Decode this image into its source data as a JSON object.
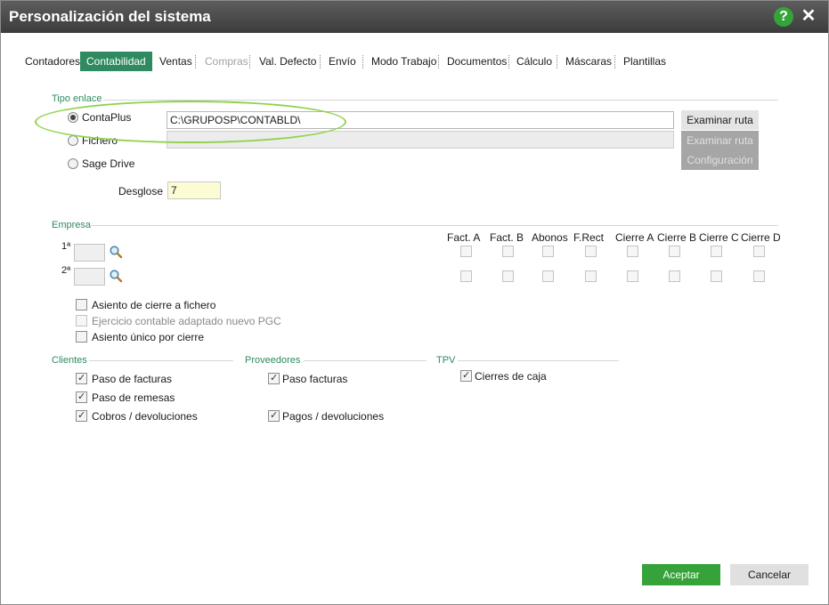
{
  "window": {
    "title": "Personalización del sistema"
  },
  "titlebar": {
    "help_icon": "help-icon",
    "close_icon": "close-icon",
    "help_glyph": "?",
    "close_glyph": "✕"
  },
  "tabs": [
    {
      "label": "Contadores",
      "state": "normal"
    },
    {
      "label": "Contabilidad",
      "state": "active"
    },
    {
      "label": "Ventas",
      "state": "normal"
    },
    {
      "label": "Compras",
      "state": "disabled"
    },
    {
      "label": "Val. Defecto",
      "state": "normal"
    },
    {
      "label": "Envío",
      "state": "normal"
    },
    {
      "label": "Modo Trabajo",
      "state": "normal"
    },
    {
      "label": "Documentos",
      "state": "normal"
    },
    {
      "label": "Cálculo",
      "state": "normal"
    },
    {
      "label": "Máscaras",
      "state": "normal"
    },
    {
      "label": "Plantillas",
      "state": "normal"
    }
  ],
  "tipo_enlace": {
    "section_label": "Tipo enlace",
    "options": [
      {
        "label": "ContaPlus",
        "checked": true
      },
      {
        "label": "Fichero",
        "checked": false
      },
      {
        "label": "Sage Drive",
        "checked": false
      }
    ],
    "path_value": "C:\\GRUPOSP\\CONTABLD\\",
    "fichero_value": "",
    "examinar_ruta_1": "Examinar ruta",
    "examinar_ruta_2": "Examinar ruta",
    "configuracion": "Configuración",
    "desglose_label": "Desglose",
    "desglose_value": "7"
  },
  "empresa": {
    "section_label": "Empresa",
    "row1_label": "1ª",
    "row2_label": "2ª",
    "columns": [
      "Fact. A",
      "Fact. B",
      "Abonos",
      "F.Rect",
      "Cierre A",
      "Cierre B",
      "Cierre C",
      "Cierre D"
    ],
    "options": [
      {
        "label": "Asiento de cierre a fichero",
        "checked": false,
        "disabled": false
      },
      {
        "label": "Ejercicio contable adaptado nuevo PGC",
        "checked": false,
        "disabled": true
      },
      {
        "label": "Asiento único por cierre",
        "checked": false,
        "disabled": false
      }
    ]
  },
  "clientes": {
    "section_label": "Clientes",
    "options": [
      {
        "label": "Paso de facturas",
        "checked": true
      },
      {
        "label": "Paso de remesas",
        "checked": true
      },
      {
        "label": "Cobros / devoluciones",
        "checked": true
      }
    ]
  },
  "proveedores": {
    "section_label": "Proveedores",
    "options": [
      {
        "label": "Paso facturas",
        "checked": true
      },
      {
        "label": "Pagos / devoluciones",
        "checked": true
      }
    ]
  },
  "tpv": {
    "section_label": "TPV",
    "options": [
      {
        "label": "Cierres de caja",
        "checked": true
      }
    ]
  },
  "footer": {
    "accept_label": "Aceptar",
    "cancel_label": "Cancelar"
  },
  "colors": {
    "accent": "#2f8a60",
    "titlebar": "#4a4a4a",
    "accept": "#36a33a",
    "highlight_ellipse": "#8fd24c"
  }
}
